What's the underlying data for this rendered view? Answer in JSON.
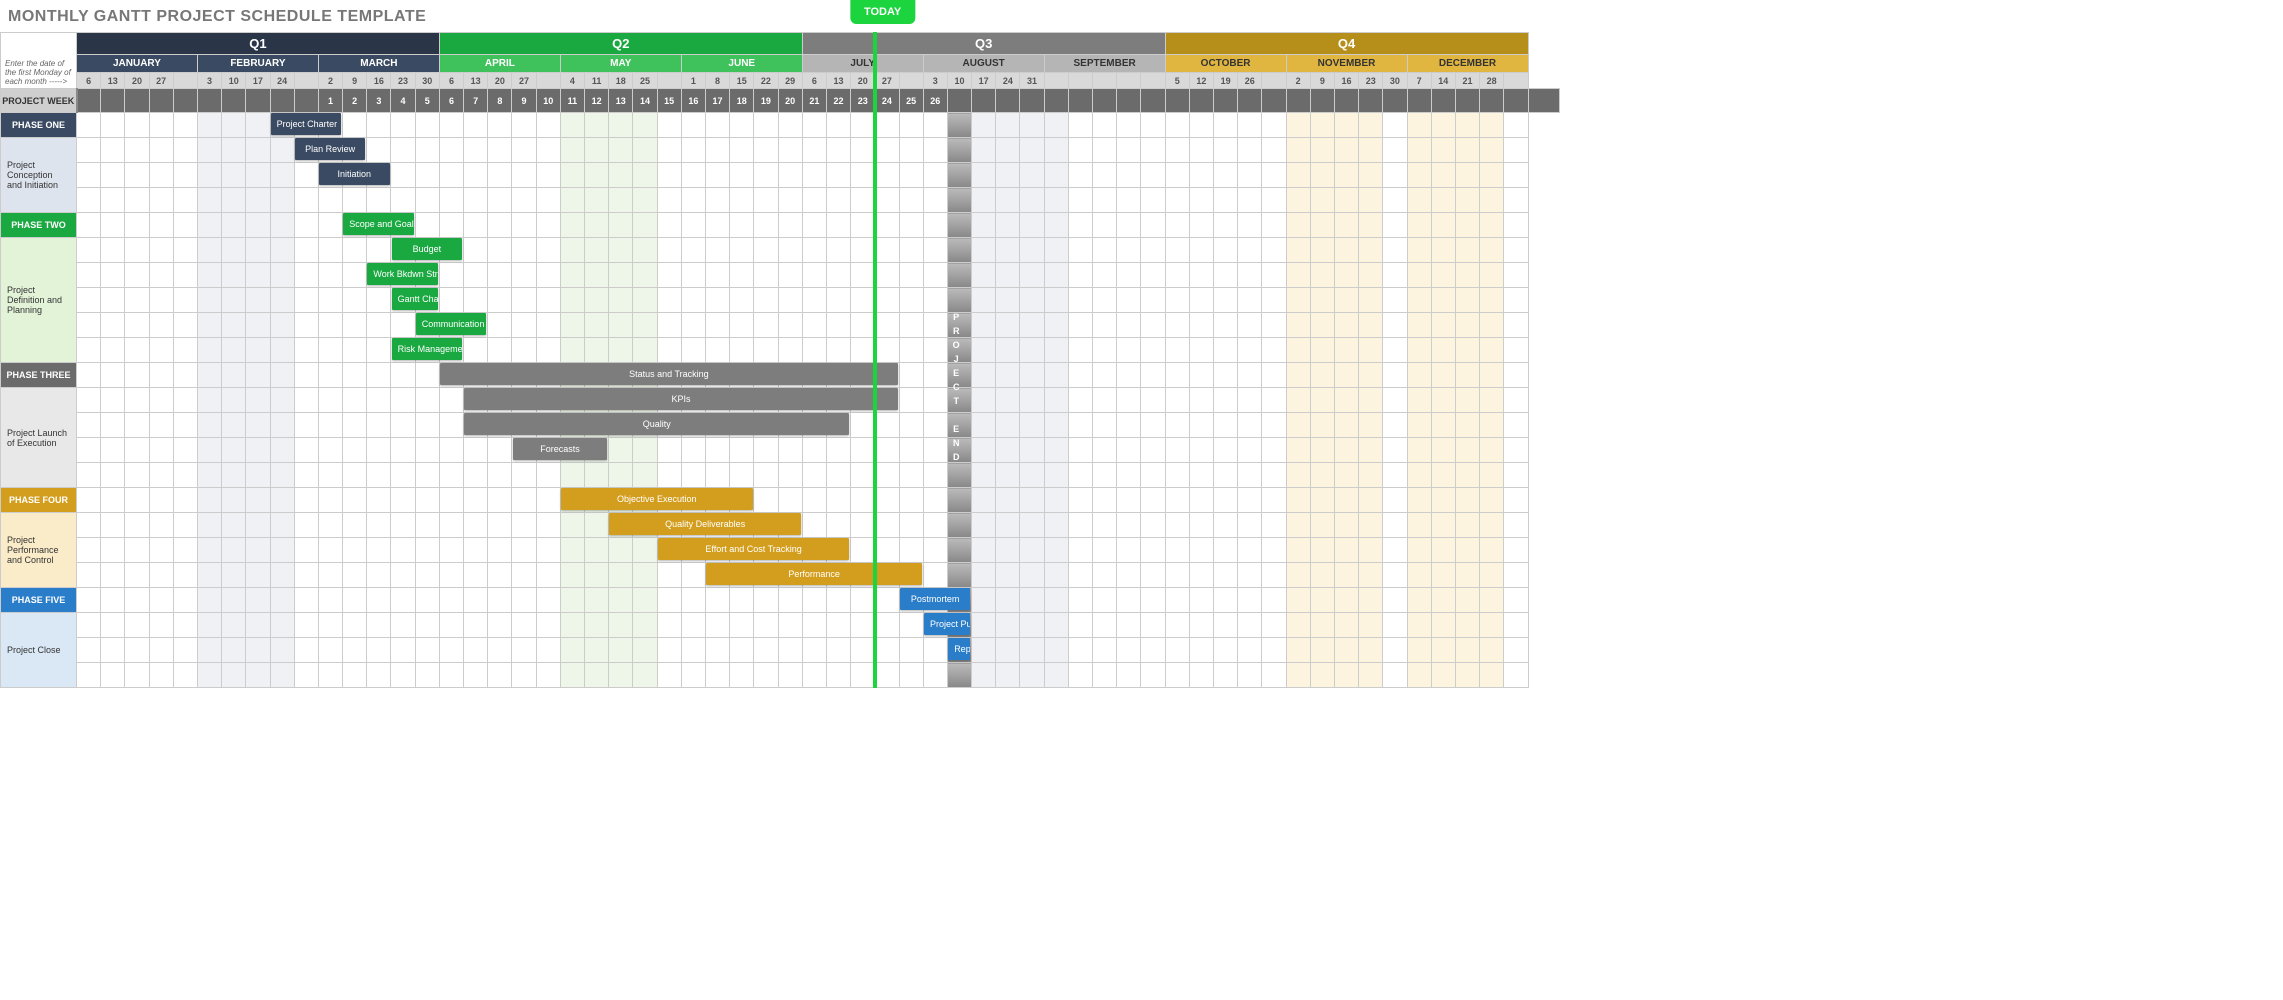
{
  "title": "MONTHLY GANTT PROJECT SCHEDULE TEMPLATE",
  "sidebar_note": "Enter the date of the first Monday of each month ----->",
  "today_label": "TODAY",
  "project_week_label": "PROJECT WEEK",
  "project_end_label": "PROJECT END",
  "quarters": [
    {
      "name": "Q1",
      "class": "q1",
      "months": [
        {
          "name": "JANUARY",
          "days": [
            "6",
            "13",
            "20",
            "27",
            ""
          ]
        },
        {
          "name": "FEBRUARY",
          "days": [
            "3",
            "10",
            "17",
            "24",
            ""
          ]
        },
        {
          "name": "MARCH",
          "days": [
            "2",
            "9",
            "16",
            "23",
            "30"
          ]
        }
      ]
    },
    {
      "name": "Q2",
      "class": "q2",
      "months": [
        {
          "name": "APRIL",
          "days": [
            "6",
            "13",
            "20",
            "27",
            ""
          ]
        },
        {
          "name": "MAY",
          "days": [
            "4",
            "11",
            "18",
            "25",
            ""
          ]
        },
        {
          "name": "JUNE",
          "days": [
            "1",
            "8",
            "15",
            "22",
            "29"
          ]
        }
      ]
    },
    {
      "name": "Q3",
      "class": "q3",
      "months": [
        {
          "name": "JULY",
          "days": [
            "6",
            "13",
            "20",
            "27",
            ""
          ]
        },
        {
          "name": "AUGUST",
          "days": [
            "3",
            "10",
            "17",
            "24",
            "31"
          ]
        },
        {
          "name": "SEPTEMBER",
          "days": [
            "",
            "",
            "",
            "",
            ""
          ]
        }
      ]
    },
    {
      "name": "Q4",
      "class": "q4",
      "months": [
        {
          "name": "OCTOBER",
          "days": [
            "5",
            "12",
            "19",
            "26",
            ""
          ]
        },
        {
          "name": "NOVEMBER",
          "days": [
            "2",
            "9",
            "16",
            "23",
            "30"
          ]
        },
        {
          "name": "DECEMBER",
          "days": [
            "7",
            "14",
            "21",
            "28",
            ""
          ]
        }
      ]
    }
  ],
  "project_weeks": [
    "",
    "",
    "",
    "",
    "",
    "",
    "",
    "",
    "",
    "",
    "1",
    "2",
    "3",
    "4",
    "5",
    "6",
    "7",
    "8",
    "9",
    "10",
    "11",
    "12",
    "13",
    "14",
    "15",
    "16",
    "17",
    "18",
    "19",
    "20",
    "21",
    "22",
    "23",
    "24",
    "25",
    "26",
    "",
    "",
    "",
    "",
    "",
    "",
    "",
    "",
    "",
    "",
    "",
    "",
    "",
    "",
    "",
    "",
    "",
    "",
    "",
    "",
    "",
    "",
    "",
    "",
    ""
  ],
  "phases": [
    {
      "hdr": "PHASE ONE",
      "hclass": "ph1",
      "body": "Project Conception and Initiation",
      "bclass": "pb1",
      "rows": 4
    },
    {
      "hdr": "PHASE TWO",
      "hclass": "ph2",
      "body": "Project Definition and Planning",
      "bclass": "pb2",
      "rows": 6
    },
    {
      "hdr": "PHASE THREE",
      "hclass": "ph3",
      "body": "Project Launch of Execution",
      "bclass": "pb3",
      "rows": 5
    },
    {
      "hdr": "PHASE FOUR",
      "hclass": "ph4",
      "body": "Project Performance and Control",
      "bclass": "pb4",
      "rows": 4
    },
    {
      "hdr": "PHASE FIVE",
      "hclass": "ph5",
      "body": "Project Close",
      "bclass": "pb5",
      "rows": 4
    }
  ],
  "tasks": [
    {
      "label": "Project Charter",
      "row": 0,
      "start": 8,
      "span": 3,
      "cls": "dark"
    },
    {
      "label": "Plan Review",
      "row": 1,
      "start": 9,
      "span": 3,
      "cls": "dark"
    },
    {
      "label": "Initiation",
      "row": 2,
      "start": 10,
      "span": 3,
      "cls": "dark"
    },
    {
      "label": "Scope and Goal Setting",
      "row": 4,
      "start": 11,
      "span": 3,
      "cls": "green"
    },
    {
      "label": "Budget",
      "row": 5,
      "start": 13,
      "span": 3,
      "cls": "green"
    },
    {
      "label": "Work Bkdwn Structure",
      "row": 6,
      "start": 12,
      "span": 3,
      "cls": "green"
    },
    {
      "label": "Gantt Chart",
      "row": 7,
      "start": 13,
      "span": 2,
      "cls": "green"
    },
    {
      "label": "Communication Plan",
      "row": 8,
      "start": 14,
      "span": 3,
      "cls": "green"
    },
    {
      "label": "Risk Management",
      "row": 9,
      "start": 13,
      "span": 3,
      "cls": "green"
    },
    {
      "label": "Status  and Tracking",
      "row": 10,
      "start": 15,
      "span": 19,
      "cls": "gray"
    },
    {
      "label": "KPIs",
      "row": 11,
      "start": 16,
      "span": 18,
      "cls": "gray"
    },
    {
      "label": "Quality",
      "row": 12,
      "start": 16,
      "span": 16,
      "cls": "gray"
    },
    {
      "label": "Forecasts",
      "row": 13,
      "start": 18,
      "span": 4,
      "cls": "gray"
    },
    {
      "label": "Objective Execution",
      "row": 15,
      "start": 20,
      "span": 8,
      "cls": "gold"
    },
    {
      "label": "Quality Deliverables",
      "row": 16,
      "start": 22,
      "span": 8,
      "cls": "gold"
    },
    {
      "label": "Effort and Cost Tracking",
      "row": 17,
      "start": 24,
      "span": 8,
      "cls": "gold"
    },
    {
      "label": "Performance",
      "row": 18,
      "start": 26,
      "span": 9,
      "cls": "gold"
    },
    {
      "label": "Postmortem",
      "row": 19,
      "start": 34,
      "span": 3,
      "cls": "blue"
    },
    {
      "label": "Project Punchlist",
      "row": 20,
      "start": 35,
      "span": 2,
      "cls": "blue"
    },
    {
      "label": "Report",
      "row": 21,
      "start": 36,
      "span": 1,
      "cls": "blue"
    }
  ],
  "shadings": [
    {
      "start": 5,
      "span": 4,
      "cls": "shade-q1"
    },
    {
      "start": 20,
      "span": 4,
      "cls": "shade-q2"
    },
    {
      "start": 36,
      "span": 1,
      "cls": "shade-end"
    },
    {
      "start": 37,
      "span": 4,
      "cls": "shade-q1"
    },
    {
      "start": 50,
      "span": 4,
      "cls": "shade-q4"
    },
    {
      "start": 55,
      "span": 4,
      "cls": "shade-q4"
    }
  ],
  "today_col": 33,
  "project_end_col": 36,
  "chart_data": {
    "type": "gantt",
    "time_axis": "weekly columns grouped by month and quarter (Jan–Dec 2020)",
    "tasks_reference": "see tasks[] — start is 0-indexed week-column within the 60-col grid, span is duration in week-columns",
    "project_weeks_labeled": {
      "first": 1,
      "last": 26,
      "starts_at_column": 10
    },
    "today_marker_column": 33,
    "project_end_column": 36
  }
}
